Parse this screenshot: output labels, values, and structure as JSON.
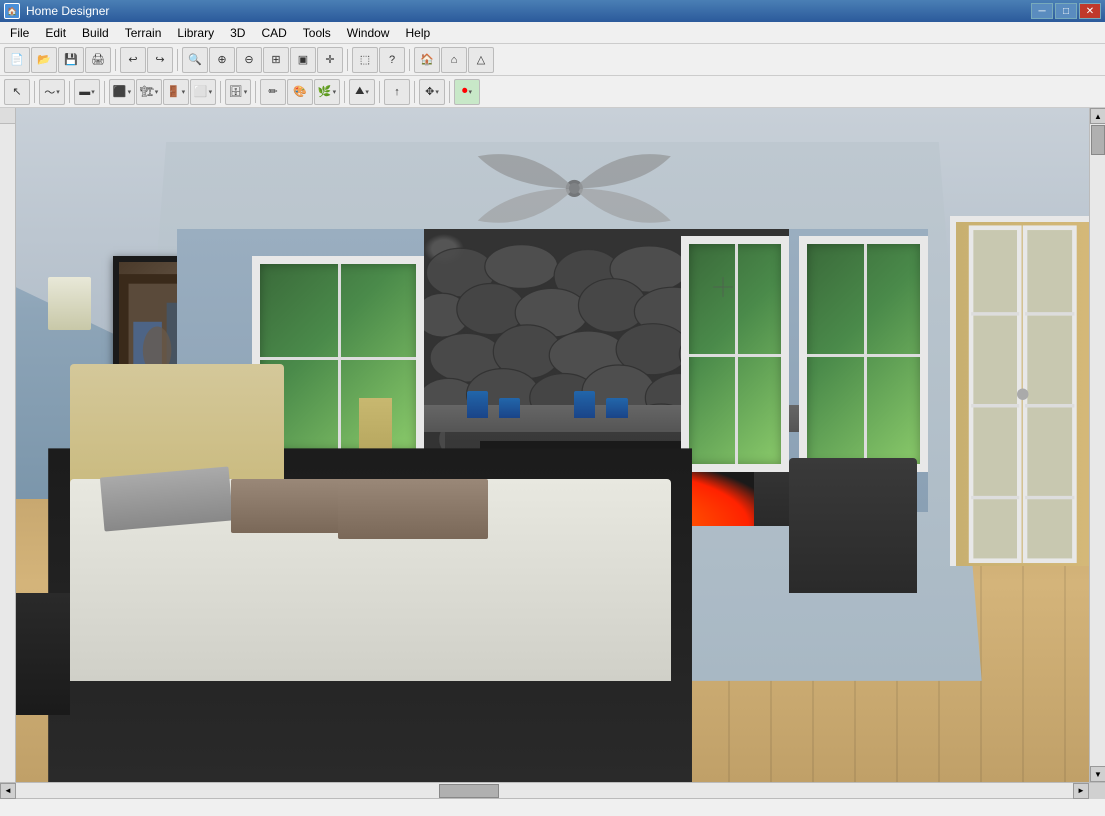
{
  "window": {
    "title": "Home Designer",
    "icon": "🏠"
  },
  "titlebar": {
    "controls": {
      "minimize": "─",
      "maximize": "□",
      "close": "✕"
    }
  },
  "menubar": {
    "items": [
      {
        "id": "file",
        "label": "File"
      },
      {
        "id": "edit",
        "label": "Edit"
      },
      {
        "id": "build",
        "label": "Build"
      },
      {
        "id": "terrain",
        "label": "Terrain"
      },
      {
        "id": "library",
        "label": "Library"
      },
      {
        "id": "3d",
        "label": "3D"
      },
      {
        "id": "cad",
        "label": "CAD"
      },
      {
        "id": "tools",
        "label": "Tools"
      },
      {
        "id": "window",
        "label": "Window"
      },
      {
        "id": "help",
        "label": "Help"
      }
    ]
  },
  "toolbar1": {
    "buttons": [
      {
        "id": "new",
        "icon": "📄",
        "label": "New"
      },
      {
        "id": "open",
        "icon": "📂",
        "label": "Open"
      },
      {
        "id": "save",
        "icon": "💾",
        "label": "Save"
      },
      {
        "id": "print",
        "icon": "🖨",
        "label": "Print"
      },
      {
        "id": "undo",
        "icon": "↩",
        "label": "Undo"
      },
      {
        "id": "redo",
        "icon": "↪",
        "label": "Redo"
      },
      {
        "id": "zoom-in",
        "icon": "🔍",
        "label": "Zoom In"
      },
      {
        "id": "zoom-out",
        "icon": "🔎",
        "label": "Zoom Out"
      },
      {
        "id": "zoom-fit",
        "icon": "⊞",
        "label": "Fit View"
      }
    ]
  },
  "toolbar2": {
    "buttons": [
      {
        "id": "select",
        "icon": "↖",
        "label": "Select"
      },
      {
        "id": "draw",
        "icon": "✏",
        "label": "Draw"
      },
      {
        "id": "wall",
        "icon": "▬",
        "label": "Wall"
      },
      {
        "id": "room",
        "icon": "⬛",
        "label": "Room"
      },
      {
        "id": "stairs",
        "icon": "🏗",
        "label": "Stairs"
      },
      {
        "id": "door",
        "icon": "🚪",
        "label": "Door"
      },
      {
        "id": "window",
        "icon": "🪟",
        "label": "Window"
      },
      {
        "id": "cabinet",
        "icon": "🗄",
        "label": "Cabinet"
      },
      {
        "id": "material",
        "icon": "🎨",
        "label": "Material"
      },
      {
        "id": "plant",
        "icon": "🌿",
        "label": "Plant"
      },
      {
        "id": "terrain-tool",
        "icon": "⛰",
        "label": "Terrain"
      },
      {
        "id": "arrow",
        "icon": "↑",
        "label": "Arrow"
      },
      {
        "id": "move",
        "icon": "✥",
        "label": "Move"
      },
      {
        "id": "record",
        "icon": "⏺",
        "label": "Record"
      }
    ]
  },
  "viewport": {
    "scene": "3D Bedroom View",
    "description": "Bedroom with fireplace, king bed, artwork, windows"
  },
  "statusbar": {
    "text": ""
  }
}
